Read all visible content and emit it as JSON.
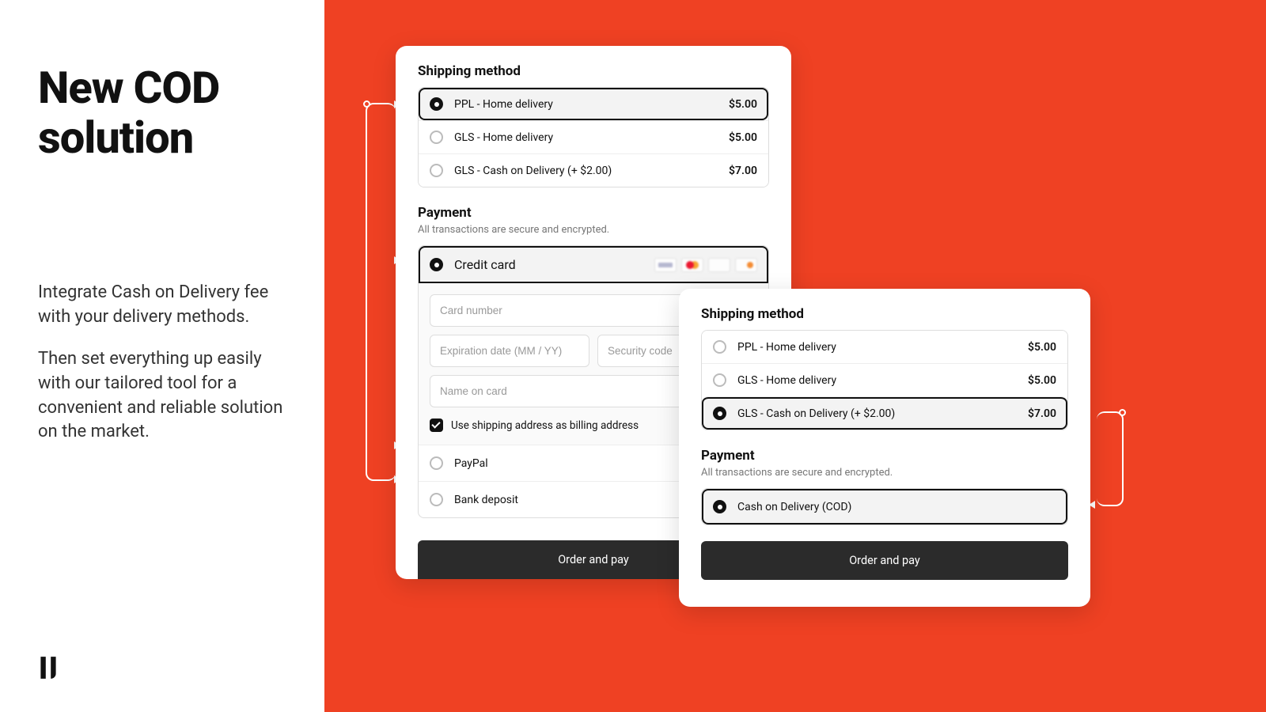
{
  "hero": {
    "title": "New COD solution",
    "desc1": "Integrate Cash on Delivery fee with your delivery methods.",
    "desc2": "Then set everything up easily with our tailored tool for a convenient and reliable solution on the market."
  },
  "panelA": {
    "shipping_title": "Shipping method",
    "shipping": [
      {
        "label": "PPL - Home delivery",
        "price": "$5.00",
        "selected": true
      },
      {
        "label": "GLS - Home delivery",
        "price": "$5.00",
        "selected": false
      },
      {
        "label": "GLS - Cash on Delivery (+ $2.00)",
        "price": "$7.00",
        "selected": false
      }
    ],
    "payment_title": "Payment",
    "payment_sub": "All transactions are secure and encrypted.",
    "cc_label": "Credit card",
    "card_number_ph": "Card number",
    "exp_ph": "Expiration date (MM / YY)",
    "cvc_ph": "Security code",
    "name_ph": "Name on card",
    "billing_same": "Use shipping address as billing address",
    "paypal": "PayPal",
    "bank": "Bank deposit",
    "cta": "Order and pay"
  },
  "panelB": {
    "shipping_title": "Shipping method",
    "shipping": [
      {
        "label": "PPL - Home delivery",
        "price": "$5.00",
        "selected": false
      },
      {
        "label": "GLS - Home delivery",
        "price": "$5.00",
        "selected": false
      },
      {
        "label": "GLS - Cash on Delivery (+ $2.00)",
        "price": "$7.00",
        "selected": true
      }
    ],
    "payment_title": "Payment",
    "payment_sub": "All transactions are secure and encrypted.",
    "cod_label": "Cash on Delivery (COD)",
    "cta": "Order and pay"
  }
}
